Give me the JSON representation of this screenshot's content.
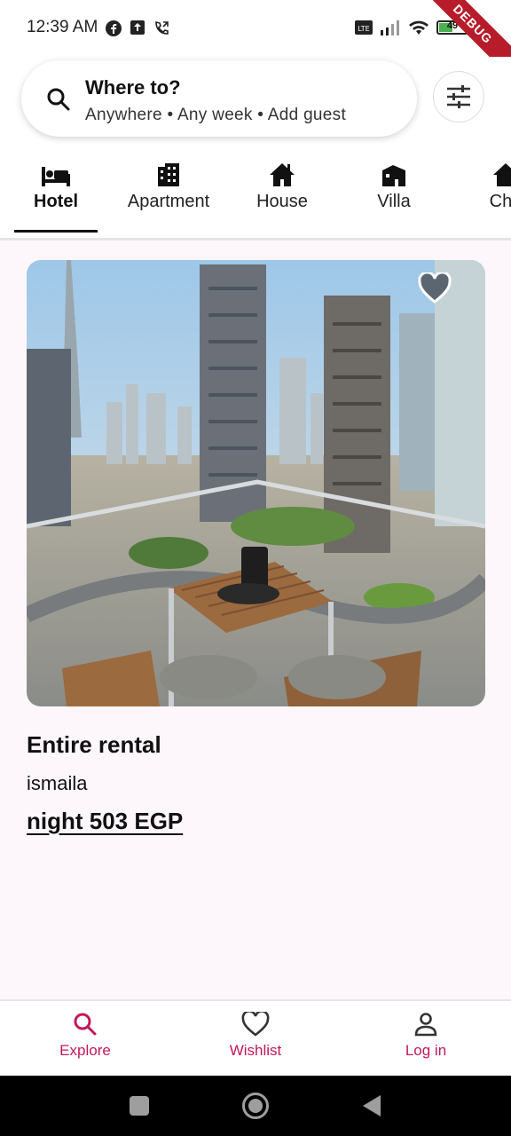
{
  "status_bar": {
    "time": "12:39 AM",
    "battery": "49",
    "debug_label": "DEBUG"
  },
  "search": {
    "title": "Where to?",
    "subtitle": "Anywhere • Any week • Add guest"
  },
  "categories": [
    {
      "label": "Hotel",
      "icon": "hotel-bed-icon",
      "active": true
    },
    {
      "label": "Apartment",
      "icon": "apartment-icon",
      "active": false
    },
    {
      "label": "House",
      "icon": "house-icon",
      "active": false
    },
    {
      "label": "Villa",
      "icon": "villa-icon",
      "active": false
    },
    {
      "label": "Cha",
      "icon": "chalet-icon",
      "active": false
    }
  ],
  "listing": {
    "title": "Entire rental",
    "host": "ismaila",
    "price": "night 503 EGP"
  },
  "bottom_nav": [
    {
      "label": "Explore",
      "icon": "search-icon"
    },
    {
      "label": "Wishlist",
      "icon": "heart-icon"
    },
    {
      "label": "Log in",
      "icon": "person-icon"
    }
  ],
  "colors": {
    "accent": "#c2185b",
    "background": "#fdf7fb"
  }
}
